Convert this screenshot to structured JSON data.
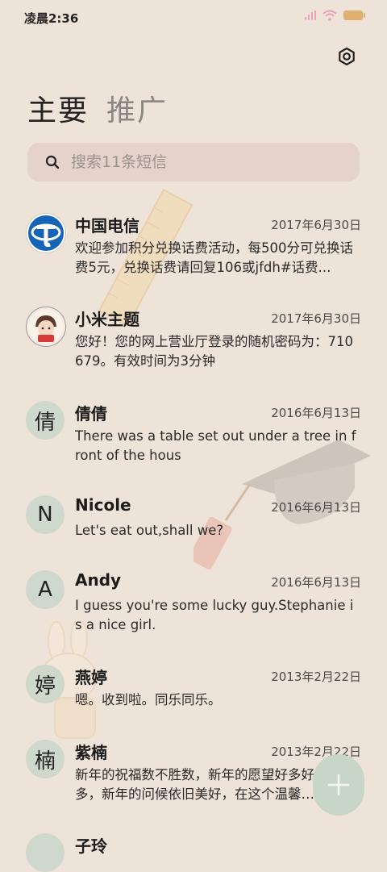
{
  "status_bar": {
    "time": "凌晨2:36"
  },
  "header": {
    "settings_icon": "settings-icon",
    "tabs": [
      {
        "label": "主要",
        "active": true
      },
      {
        "label": "推广",
        "active": false
      }
    ]
  },
  "search": {
    "placeholder": "搜索11条短信",
    "value": ""
  },
  "messages": [
    {
      "sender": "中国电信",
      "date": "2017年6月30日",
      "preview": "欢迎参加积分兑换话费活动，每500分可兑换话费5元，兑换话费请回复106或jfdh#话费...",
      "avatar_type": "logo-china-telecom"
    },
    {
      "sender": "小米主题",
      "date": "2017年6月30日",
      "preview": "您好！您的网上营业厅登录的随机密码为：710679。有效时间为3分钟",
      "avatar_type": "logo-mi-theme"
    },
    {
      "sender": "倩倩",
      "date": "2016年6月13日",
      "preview": "There was a table set out under a tree in front of the hous",
      "avatar_letter": "倩"
    },
    {
      "sender": "Nicole",
      "date": "2016年6月13日",
      "preview": "Let's eat out,shall we?",
      "avatar_letter": "N"
    },
    {
      "sender": "Andy",
      "date": "2016年6月13日",
      "preview": "I guess you're some lucky guy.Stephanie is a nice girl.",
      "avatar_letter": "A"
    },
    {
      "sender": "燕婷",
      "date": "2013年2月22日",
      "preview": "嗯。收到啦。同乐同乐。",
      "avatar_letter": "婷"
    },
    {
      "sender": "紫楠",
      "date": "2013年2月22日",
      "preview": "新年的祝福数不胜数，新年的愿望好多好多，新年的问候依旧美好，在这个温馨的时刻",
      "avatar_letter": "楠"
    },
    {
      "sender": "子玲",
      "date": "",
      "preview": "",
      "avatar_letter": ""
    }
  ],
  "fab": {
    "icon": "plus-icon"
  },
  "colors": {
    "background": "#eee3d8",
    "search_bg": "#e5d2ca",
    "avatar_bg": "#cfd8cc",
    "fab_bg": "#c8d6c8"
  }
}
